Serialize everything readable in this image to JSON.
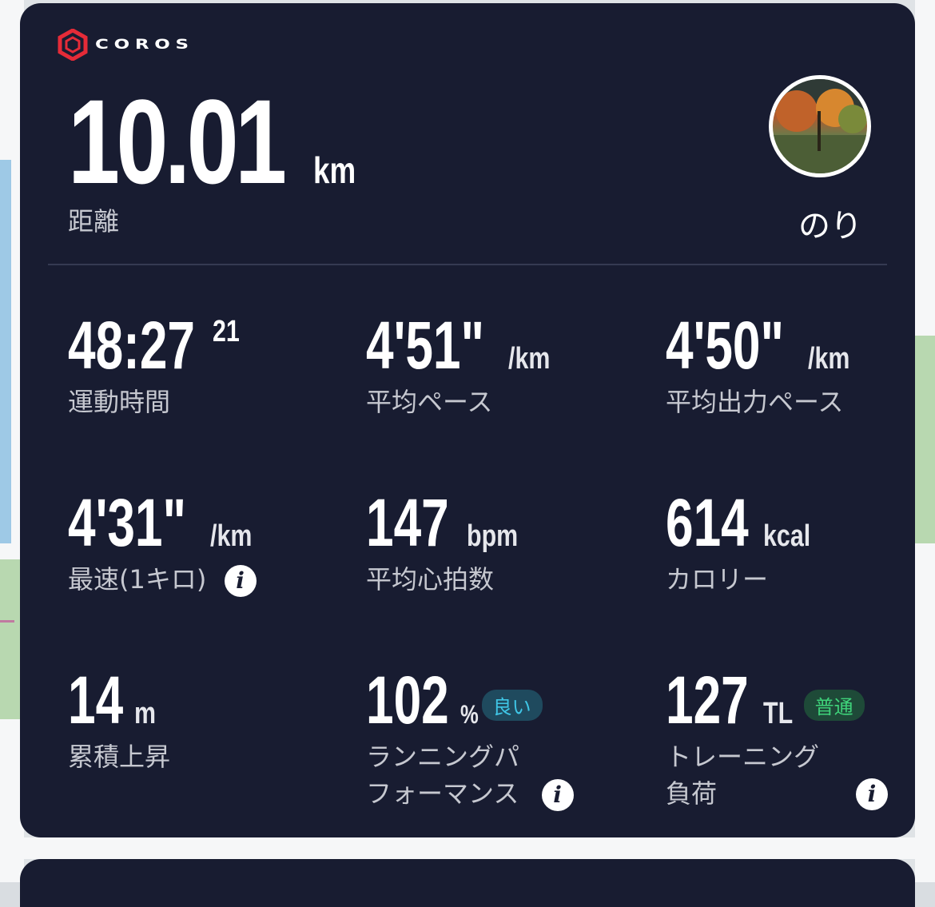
{
  "brand": {
    "name": "COROS",
    "logo_icon": "coros-hexagon-icon",
    "accent": "#e52b38"
  },
  "summary": {
    "distance_value": "10.01",
    "distance_unit": "km",
    "distance_label": "距離",
    "user_name": "のり"
  },
  "stats": [
    {
      "value": "48:27",
      "sup": "21",
      "unit": "",
      "label": "運動時間"
    },
    {
      "value": "4'51\"",
      "unit": "/km",
      "label": "平均ペース"
    },
    {
      "value": "4'50\"",
      "unit": "/km",
      "label": "平均出力ペース"
    },
    {
      "value": "4'31\"",
      "unit": "/km",
      "label": "最速(1キロ)",
      "info": "i"
    },
    {
      "value": "147",
      "unit": "bpm",
      "label": "平均心拍数"
    },
    {
      "value": "614",
      "unit": "kcal",
      "label": "カロリー"
    },
    {
      "value": "14",
      "unit": "m",
      "label": "累積上昇"
    },
    {
      "value": "102",
      "unit": "%",
      "badge": "良い",
      "label_line1": "ランニングパ",
      "label_line2": "フォーマンス",
      "info": "i"
    },
    {
      "value": "127",
      "unit": "TL",
      "badge": "普通",
      "label_line1": "トレーニング",
      "label_line2": "負荷",
      "info": "i"
    }
  ],
  "colors": {
    "card_bg": "#181c31",
    "badge_good": "#3fc6e6",
    "badge_normal": "#3fd27a"
  }
}
